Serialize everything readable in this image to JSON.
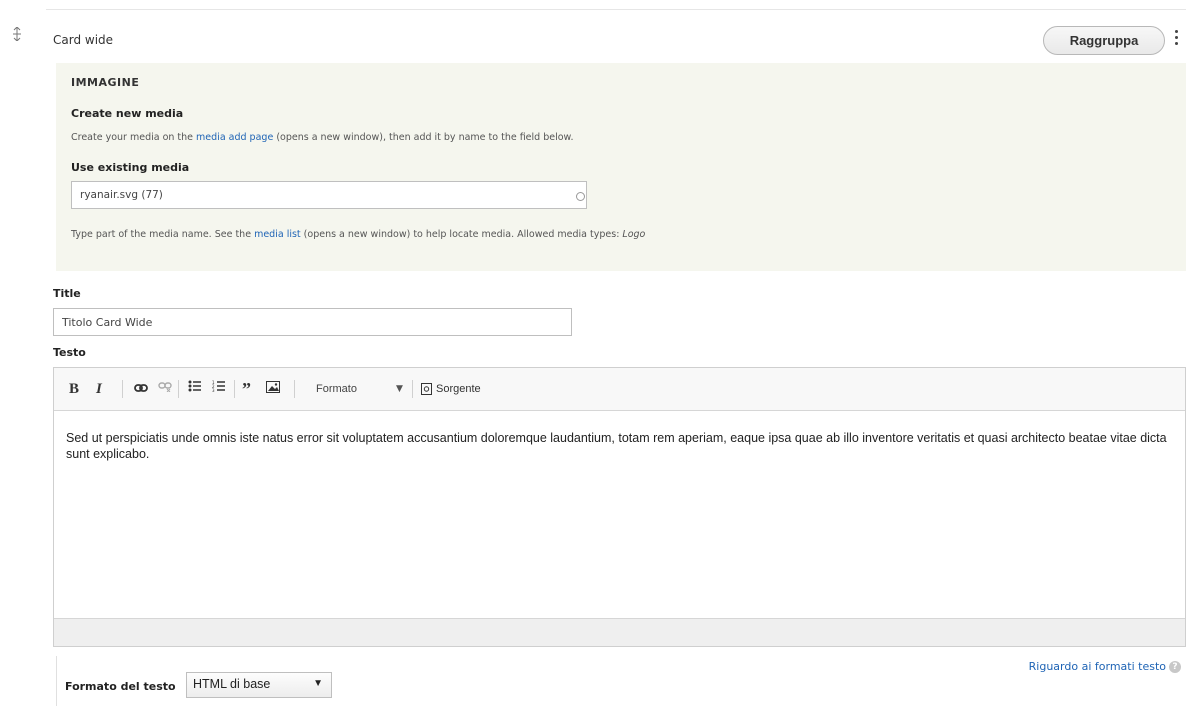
{
  "paragraph": {
    "label": "Card wide",
    "group_button": "Raggruppa"
  },
  "media": {
    "heading": "IMMAGINE",
    "create_title": "Create new media",
    "create_desc_pre": "Create your media on the ",
    "create_desc_link": "media add page",
    "create_desc_post": " (opens a new window), then add it by name to the field below.",
    "use_title": "Use existing media",
    "input_value": "ryanair.svg (77)",
    "help_pre": "Type part of the media name. See the ",
    "help_link": "media list",
    "help_post": " (opens a new window) to help locate media. Allowed media types: ",
    "help_types": "Logo"
  },
  "title_field": {
    "label": "Title",
    "value": "Titolo Card Wide"
  },
  "testo": {
    "label": "Testo",
    "toolbar": {
      "bold": "B",
      "italic": "I",
      "format": "Formato",
      "source": "Sorgente",
      "icons": [
        "bold-icon",
        "italic-icon",
        "link-icon",
        "unlink-icon",
        "bulleted-list-icon",
        "numbered-list-icon",
        "blockquote-icon",
        "image-icon",
        "source-icon"
      ]
    },
    "body": "Sed ut perspiciatis unde omnis iste natus error sit voluptatem accusantium doloremque laudantium, totam rem aperiam, eaque ipsa quae ab illo inventore veritatis et quasi architecto beatae vitae dicta sunt explicabo."
  },
  "text_format": {
    "label": "Formato del testo",
    "selected": "HTML di base",
    "help_link": "Riguardo ai formati testo"
  },
  "colors": {
    "panel_bg": "#f5f6ee",
    "link": "#1f64b5"
  }
}
